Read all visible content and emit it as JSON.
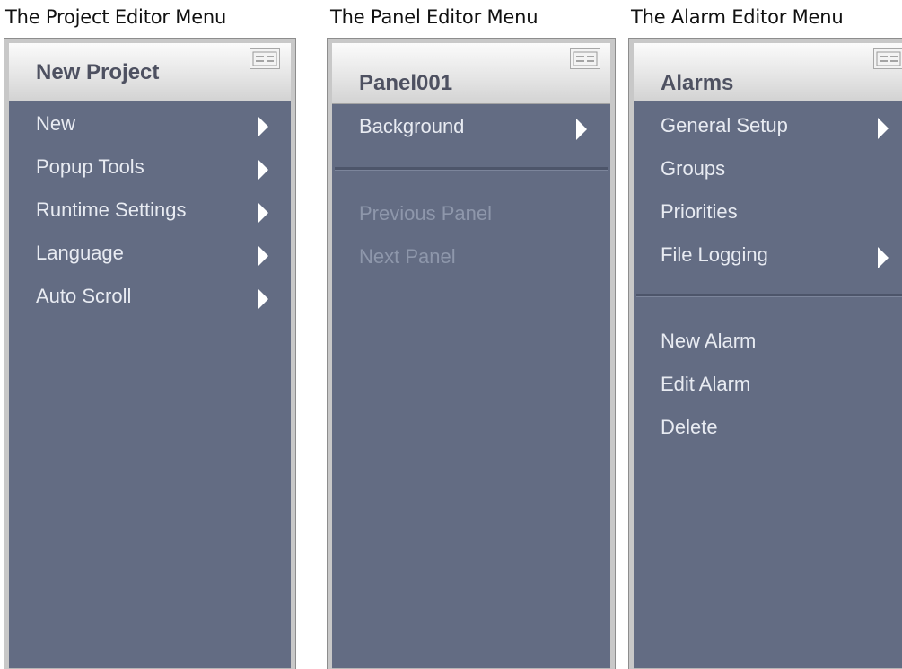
{
  "captions": {
    "project": "The Project Editor Menu",
    "panel": "The Panel Editor Menu",
    "alarm": "The Alarm Editor Menu"
  },
  "project_menu": {
    "title": "New Project",
    "icon": "menu-list-icon",
    "items": [
      {
        "label": "New",
        "submenu": true
      },
      {
        "label": "Popup Tools",
        "submenu": true
      },
      {
        "label": "Runtime Settings",
        "submenu": true
      },
      {
        "label": "Language",
        "submenu": true
      },
      {
        "label": "Auto Scroll",
        "submenu": true
      }
    ]
  },
  "panel_menu": {
    "title": "Panel001",
    "icon": "menu-list-icon",
    "items": [
      {
        "label": "Background",
        "submenu": true
      }
    ],
    "disabled_items": [
      {
        "label": "Previous Panel"
      },
      {
        "label": "Next Panel"
      }
    ]
  },
  "alarm_menu": {
    "title": "Alarms",
    "icon": "menu-list-icon",
    "items": [
      {
        "label": "General Setup",
        "submenu": true
      },
      {
        "label": "Groups",
        "submenu": false
      },
      {
        "label": "Priorities",
        "submenu": false
      },
      {
        "label": "File Logging",
        "submenu": true
      }
    ],
    "items_after_separator": [
      {
        "label": "New Alarm"
      },
      {
        "label": "Edit Alarm"
      },
      {
        "label": "Delete"
      }
    ]
  },
  "colors": {
    "panel_bg": "#636c83",
    "header_bg": "#e6e6e6",
    "item_text": "#e8ebf2",
    "disabled_text": "#8e97ab"
  }
}
